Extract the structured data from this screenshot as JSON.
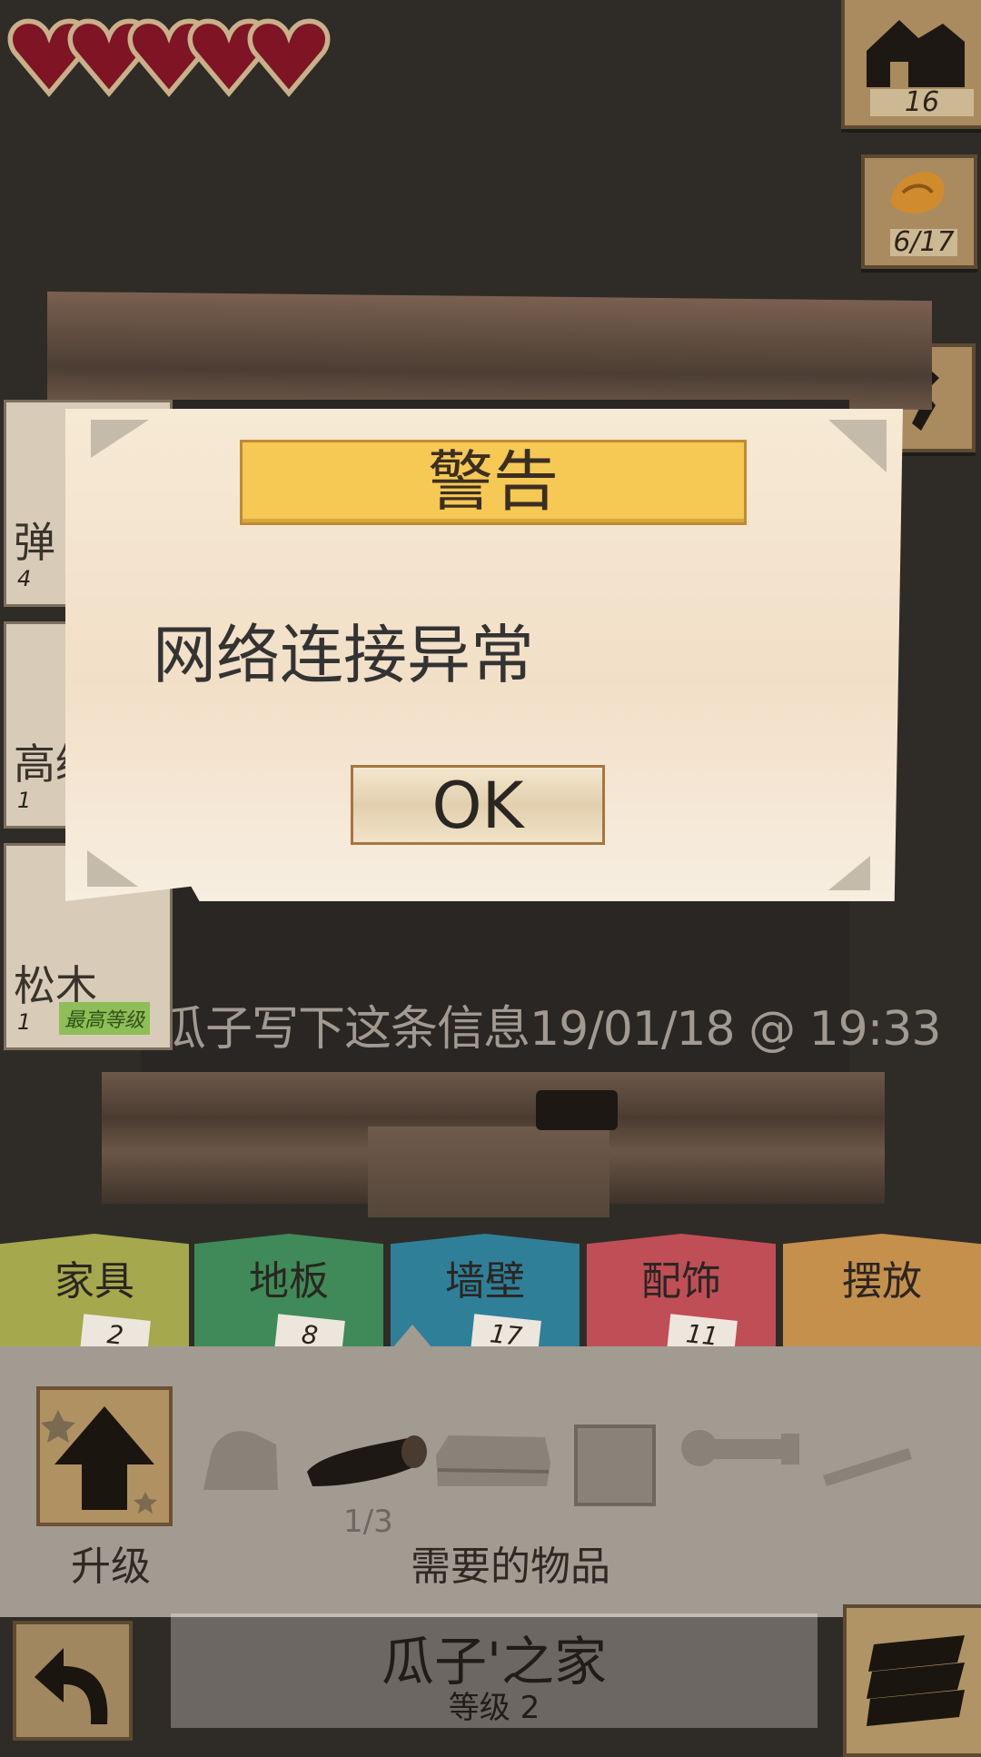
{
  "hud": {
    "hearts": 5,
    "houses_count": "16",
    "wood_count": "6/17"
  },
  "left_list": [
    {
      "label": "弹",
      "level": "4"
    },
    {
      "label": "高级",
      "level": "1"
    },
    {
      "label": "松木",
      "level": "1",
      "badge": "最高等级"
    }
  ],
  "board": {
    "note": "瓜子写下这条信息19/01/18 @ 19:33"
  },
  "dialog": {
    "title": "警告",
    "message": "网络连接异常",
    "ok_label": "OK"
  },
  "tabs": [
    {
      "label": "家具",
      "count": "2",
      "color": "#a5a84d"
    },
    {
      "label": "地板",
      "count": "8",
      "color": "#3f8a58"
    },
    {
      "label": "墙壁",
      "count": "17",
      "color": "#2f7f98"
    },
    {
      "label": "配饰",
      "count": "11",
      "color": "#c04e57"
    },
    {
      "label": "摆放",
      "count": "",
      "color": "#c58f4c"
    }
  ],
  "panel": {
    "upgrade_label": "升级",
    "page_indicator": "1/3",
    "needed_label": "需要的物品"
  },
  "footer": {
    "house_name": "瓜子'之家",
    "house_level": "等级 2"
  }
}
